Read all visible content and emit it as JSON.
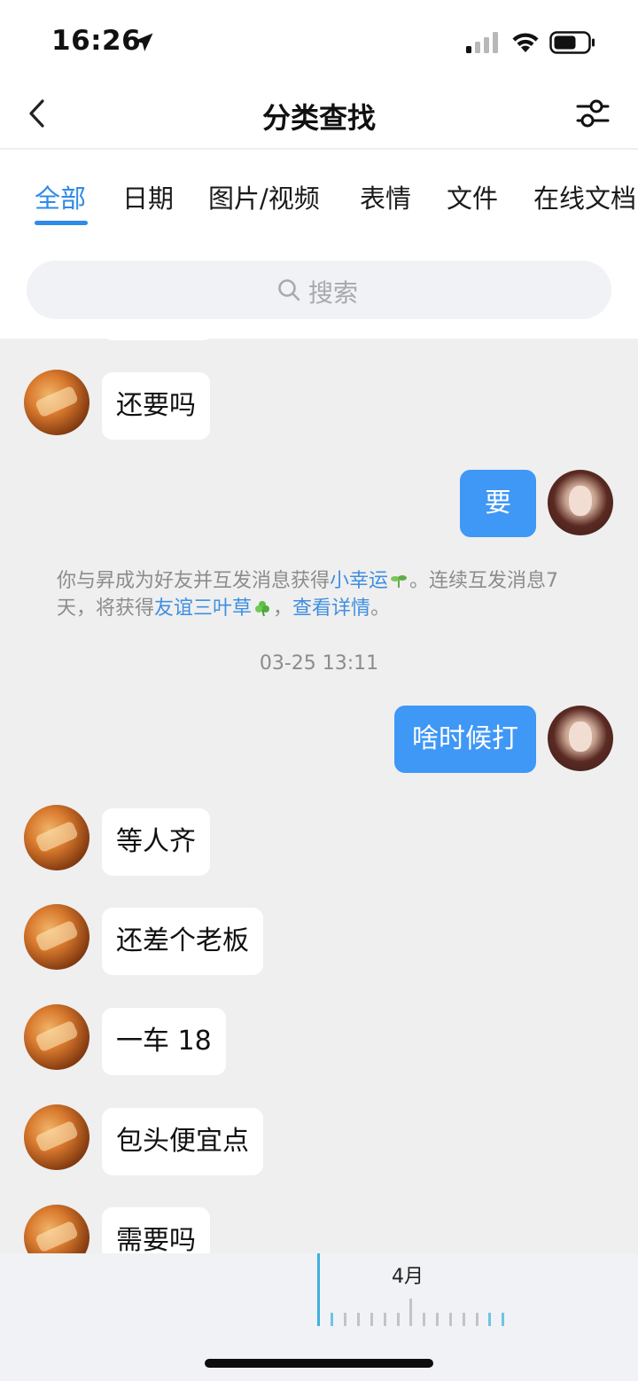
{
  "status_bar": {
    "time": "16:26",
    "icons": [
      "location-arrow-icon",
      "cellular-signal-icon",
      "wifi-icon",
      "battery-icon"
    ]
  },
  "nav": {
    "title": "分类查找",
    "back_icon": "chevron-left-icon",
    "filter_icon": "sliders-icon"
  },
  "tabs": [
    {
      "label": "全部",
      "active": true
    },
    {
      "label": "日期",
      "active": false
    },
    {
      "label": "图片/视频",
      "active": false
    },
    {
      "label": "表情",
      "active": false
    },
    {
      "label": "文件",
      "active": false
    },
    {
      "label": "在线文档",
      "active": false
    }
  ],
  "search": {
    "placeholder": "搜索"
  },
  "messages": [
    {
      "side": "in",
      "text": "还要吗"
    },
    {
      "side": "out",
      "text": "要"
    },
    {
      "side": "in",
      "text": "等人齐"
    },
    {
      "side": "out",
      "text": "啥时候打"
    },
    {
      "side": "in",
      "text": "还差个老板"
    },
    {
      "side": "in",
      "text": "一车 18"
    },
    {
      "side": "in",
      "text": "包头便宜点"
    },
    {
      "side": "in",
      "text": "需要吗"
    }
  ],
  "system_message": {
    "part1": "你与昇成为好友并互发消息获得",
    "link1": "小幸运",
    "part2": "。连续互发消息7天，将获得",
    "link2": "友谊三叶草",
    "part3": "，",
    "link3": "查看详情",
    "part4": "。"
  },
  "timestamp": "03-25 13:11",
  "timeline": {
    "month_label": "4月"
  },
  "colors": {
    "accent": "#2f8ae8",
    "outgoing_bubble": "#3f97f6",
    "background": "#efefef",
    "link": "#3f8fe0"
  }
}
